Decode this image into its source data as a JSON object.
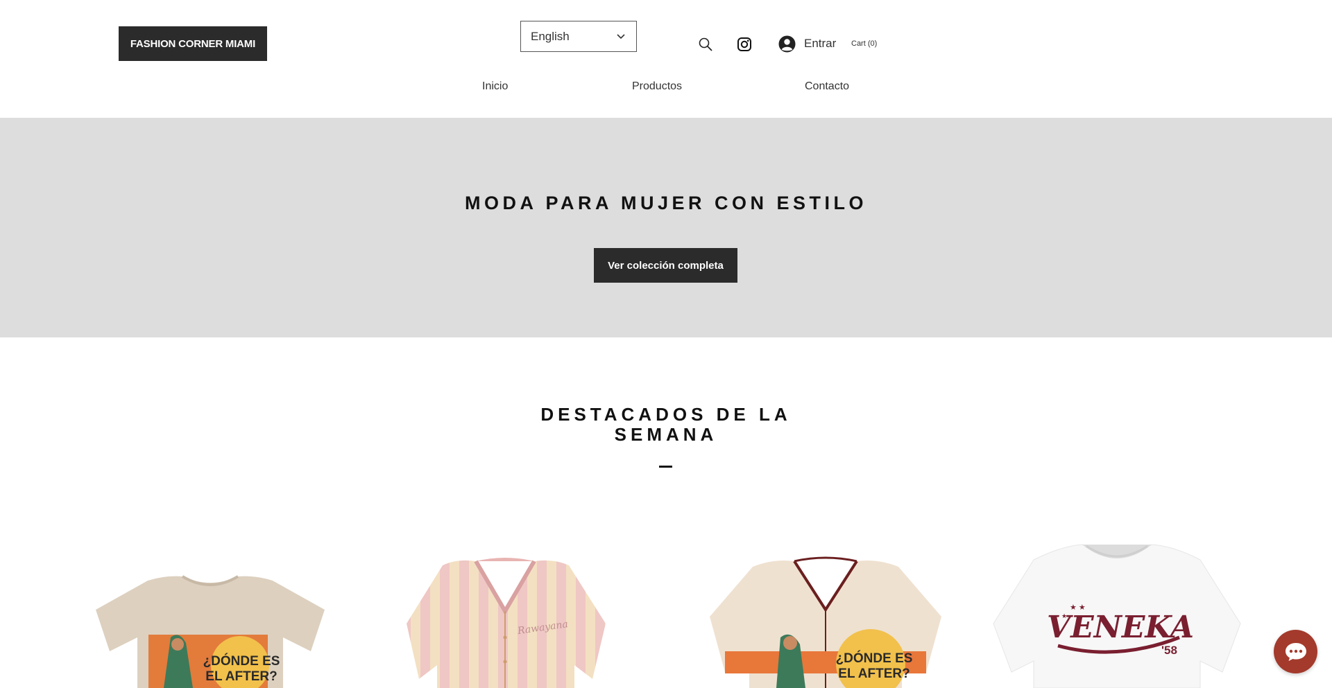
{
  "header": {
    "logo_label": "FASHION CORNER MIAMI",
    "language": {
      "selected": "English"
    },
    "login_label": "Entrar",
    "cart_label": "Cart (0)",
    "icons": [
      "search-icon",
      "instagram-icon",
      "account-icon",
      "chevron-down-icon"
    ]
  },
  "nav": {
    "items": [
      {
        "label": "Inicio"
      },
      {
        "label": "Productos"
      },
      {
        "label": "Contacto"
      }
    ]
  },
  "hero": {
    "title": "MODA PARA MUJER CON ESTILO",
    "button_label": "Ver colección completa",
    "background": "#dddddd"
  },
  "featured": {
    "title_line1": "DESTACADOS DE LA",
    "title_line2": "SEMANA",
    "products": [
      {
        "image_text_1": "¿DÓNDE ES",
        "image_text_2": "EL AFTER?"
      },
      {
        "image_text_1": "Rawayana"
      },
      {
        "image_text_1": "¿DÓNDE ES",
        "image_text_2": "EL AFTER?"
      },
      {
        "image_text_1": "VENEKA",
        "image_text_2": "'58"
      }
    ]
  },
  "colors": {
    "dark_button": "#2b2b2b",
    "chat_accent": "#a33a2c"
  },
  "chat": {
    "icon": "chat-icon"
  }
}
